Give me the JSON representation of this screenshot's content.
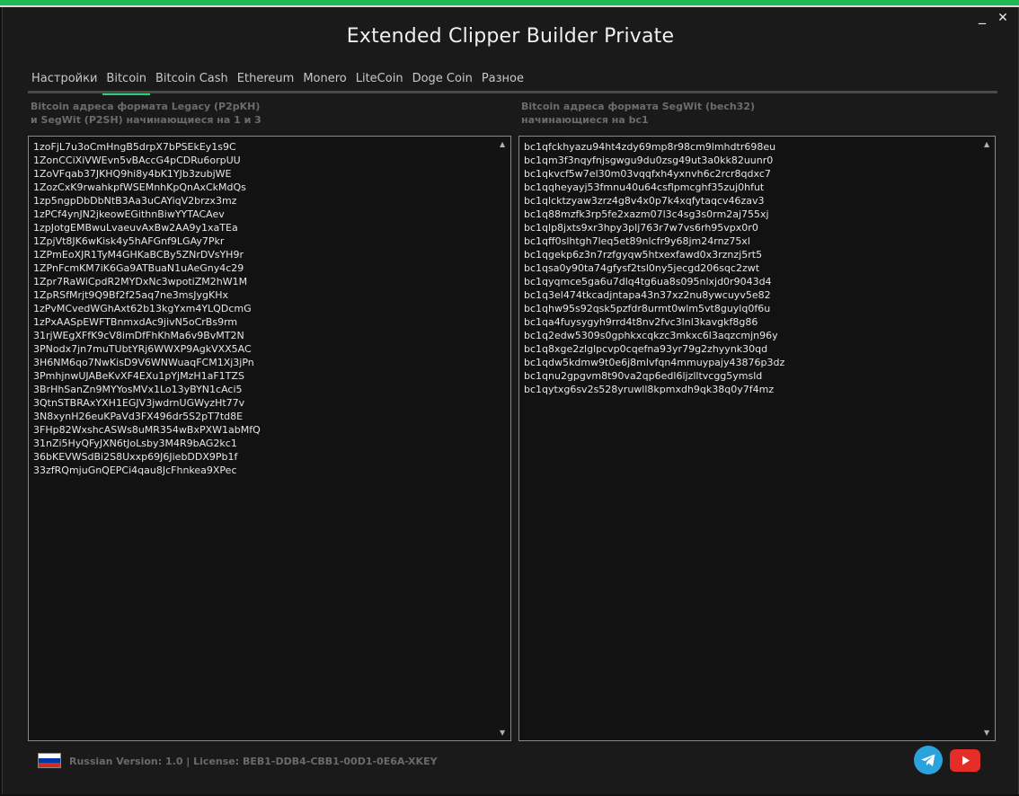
{
  "window": {
    "title": "Extended Clipper Builder Private",
    "minimize_glyph": "_",
    "close_glyph": "✕"
  },
  "tabs": [
    {
      "label": "Настройки"
    },
    {
      "label": "Bitcoin",
      "active": true
    },
    {
      "label": "Bitcoin Cash"
    },
    {
      "label": "Ethereum"
    },
    {
      "label": "Monero"
    },
    {
      "label": "LiteCoin"
    },
    {
      "label": "Doge Coin"
    },
    {
      "label": "Разное"
    }
  ],
  "left_panel": {
    "label_line1": "Bitcoin адреса формата Legacy (P2pKH)",
    "label_line2": "и SegWit (P2SH) начинающиеся на 1 и 3",
    "addresses": [
      "1zoFjL7u3oCmHngB5drpX7bPSEkEy1s9C",
      "1ZonCCiXiVWEvn5vBAccG4pCDRu6orpUU",
      "1ZoVFqab37JKHQ9hi8y4bK1YJb3zubjWE",
      "1ZozCxK9rwahkpfWSEMnhKpQnAxCkMdQs",
      "1zp5ngpDbDbNtB3Aa3uCAYiqV2brzx3mz",
      "1zPCf4ynJN2jkeowEGithnBiwYYTACAev",
      "1zpJotgEMBwuLvaeuvAxBw2AA9y1xaTEa",
      "1ZpjVt8JK6wKisk4y5hAFGnf9LGAy7Pkr",
      "1ZPmEoXJR1TyM4GHKaBCBy5ZNrDVsYH9r",
      "1ZPnFcmKM7iK6Ga9ATBuaN1uAeGny4c29",
      "1Zpr7RaWiCpdR2MYDxNc3wpotiZM2hW1M",
      "1ZpRSfMrjt9Q9Bf2f25aq7ne3msJygKHx",
      "1zPvMCvedWGhAxt62b13kgYxm4YLQDcmG",
      "1zPxAASpEWFTBnmxdAc9jivN5oCrBs9rm",
      "31rjWEgXFfK9cV8imDfFhKhMa6v9BvMT2N",
      "3PNodx7jn7muTUbtYRj6WWXP9AgkVXX5AC",
      "3H6NM6qo7NwKisD9V6WNWuaqFCM1Xj3jPn",
      "3PmhjnwUJABeKvXF4EXu1pYjMzH1aF1TZS",
      "3BrHhSanZn9MYYosMVx1Lo13yBYN1cAci5",
      "3QtnSTBRAxYXH1EGJV3jwdrnUGWyzHt77v",
      "3N8xynH26euKPaVd3FX496dr5S2pT7td8E",
      "3FHp82WxshcASWs8uMR354wBxPXW1abMfQ",
      "31nZi5HyQFyJXN6tJoLsby3M4R9bAG2kc1",
      "36bKEVWSdBi2S8Uxxp69J6JiebDDX9Pb1f",
      "33zfRQmjuGnQEPCi4qau8JcFhnkea9XPec"
    ]
  },
  "right_panel": {
    "label_line1": "Bitcoin адреса формата SegWit (bech32)",
    "label_line2": "начинающиеся на bc1",
    "addresses": [
      "bc1qfckhyazu94ht4zdy69mp8r98cm9lmhdtr698eu",
      "bc1qm3f3nqyfnjsgwgu9du0zsg49ut3a0kk82uunr0",
      "bc1qkvcf5w7el30m03vqqfxh4yxnvh6c2rcr8qdxc7",
      "bc1qqheyayj53fmnu40u64csflpmcghf35zuj0hfut",
      "bc1qlcktzyaw3zrz4g8v4x0p7k4xqfytaqcv46zav3",
      "bc1q88mzfk3rp5fe2xazm07l3c4sg3s0rm2aj755xj",
      "bc1qlp8jxts9xr3hpy3plj763r7w7vs6rh95vpx0r0",
      "bc1qff0slhtgh7leq5et89nlcfr9y68jm24rnz75xl",
      "bc1qgekp6z3n7rzfgyqw5htxexfawd0x3rznzj5rt5",
      "bc1qsa0y90ta74gfysf2tsl0ny5jecgd206sqc2zwt",
      "bc1qyqmce5ga6u7dlq4tg6ua8s095nlxjd0r9043d4",
      "bc1q3el474tkcadjntapa43n37xz2nu8ywcuyv5e82",
      "bc1qhw95s92qsk5pzfdr8urmt0wlm5vt8guylq0f6u",
      "bc1qa4fuysygyh9rrd4t8nv2fvc3lnl3kavgkf8g86",
      "bc1q2edw5309s0gphkxcqkzc3mkxc6l3aqzcmjn96y",
      "bc1q8xge2zlglpcvp0cqefna93yr79g2zhyynk30qd",
      "bc1qdw5kdmw9t0e6j8mlvfqn4mmuypajy43876p3dz",
      "bc1qnu2gpgvm8t90va2qp6edl6ljzlltvcgg5ymsld",
      "bc1qytxg6sv2s528yruwll8kpmxdh9qk38q0y7f4mz"
    ]
  },
  "scrollbar": {
    "up_glyph": "▲",
    "down_glyph": "▼"
  },
  "footer": {
    "version_license": "Russian Version: 1.0 | License: BEB1-DDB4-CBB1-00D1-0E6A-XKEY",
    "flag_colors": [
      "#ffffff",
      "#0039a6",
      "#d52b1e"
    ],
    "icons": [
      "telegram-icon",
      "youtube-icon"
    ]
  },
  "colors": {
    "accent": "#2ecc71",
    "background": "#1a1a1a",
    "textbox_bg": "#121212",
    "telegram": "#2aa3dc",
    "youtube": "#e52d27"
  }
}
